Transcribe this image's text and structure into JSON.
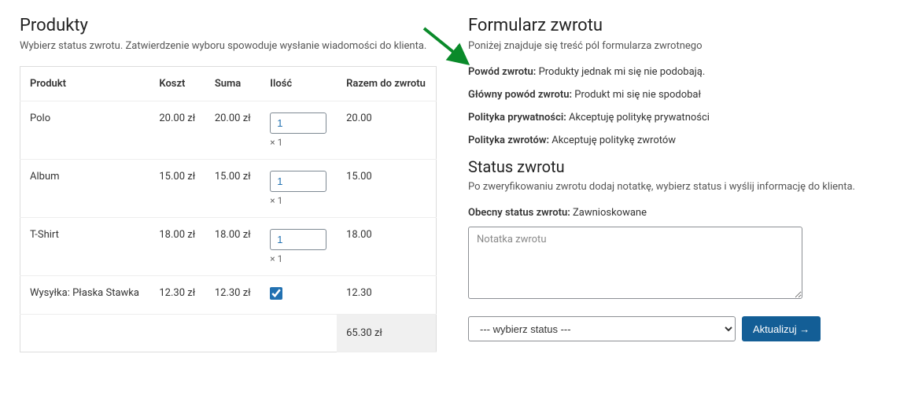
{
  "left": {
    "title": "Produkty",
    "subtitle": "Wybierz status zwrotu. Zatwierdzenie wyboru spowoduje wysłanie wiadomości do klienta.",
    "columns": {
      "product": "Produkt",
      "cost": "Koszt",
      "sum": "Suma",
      "qty": "Ilość",
      "total_return": "Razem do zwrotu"
    },
    "rows": [
      {
        "product": "Polo",
        "cost": "20.00 zł",
        "sum": "20.00 zł",
        "qty": "1",
        "qty_note": "× 1",
        "total": "20.00",
        "type": "qty"
      },
      {
        "product": "Album",
        "cost": "15.00 zł",
        "sum": "15.00 zł",
        "qty": "1",
        "qty_note": "× 1",
        "total": "15.00",
        "type": "qty"
      },
      {
        "product": "T-Shirt",
        "cost": "18.00 zł",
        "sum": "18.00 zł",
        "qty": "1",
        "qty_note": "× 1",
        "total": "18.00",
        "type": "qty"
      },
      {
        "product": "Wysyłka: Płaska Stawka",
        "cost": "12.30 zł",
        "sum": "12.30 zł",
        "qty": "",
        "qty_note": "",
        "total": "12.30",
        "type": "checkbox",
        "checked": true
      }
    ],
    "footer_total": "65.30 zł"
  },
  "right": {
    "title": "Formularz zwrotu",
    "subtitle": "Poniżej znajduje się treść pól formularza zwrotnego",
    "fields": {
      "reason_label": "Powód zwrotu:",
      "reason_value": "Produkty jednak mi się nie podobają.",
      "main_reason_label": "Główny powód zwrotu:",
      "main_reason_value": "Produkt mi się nie spodobał",
      "privacy_label": "Polityka prywatności:",
      "privacy_value": "Akceptuję politykę prywatności",
      "returns_label": "Polityka zwrotów:",
      "returns_value": "Akceptuję politykę zwrotów"
    },
    "status_title": "Status zwrotu",
    "status_subtitle": "Po zweryfikowaniu zwrotu dodaj notatkę, wybierz status i wyślij informację do klienta.",
    "current_status_label": "Obecny status zwrotu:",
    "current_status_value": "Zawnioskowane",
    "note_placeholder": "Notatka zwrotu",
    "select_placeholder": "--- wybierz status ---",
    "submit_label": "Aktualizuj →"
  }
}
